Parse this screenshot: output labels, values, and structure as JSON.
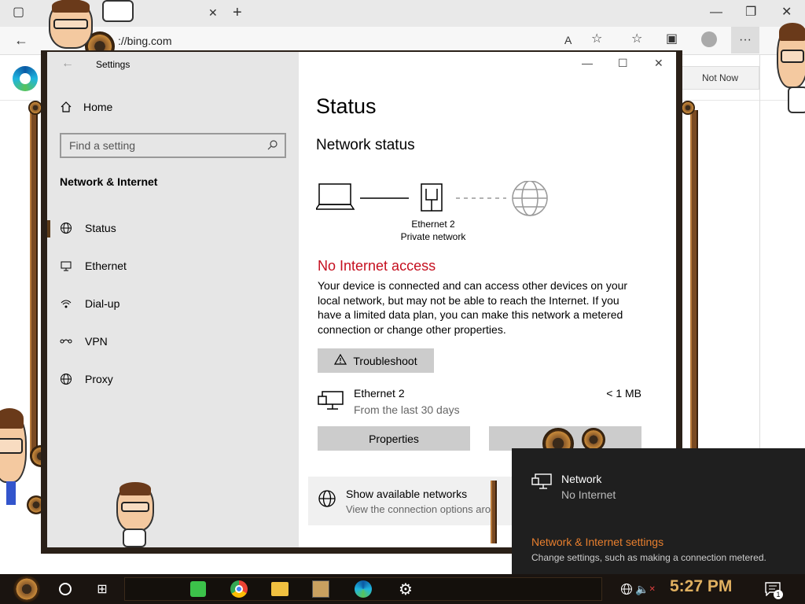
{
  "browser": {
    "url": "https://bing.com",
    "url_display": "://bing.com",
    "new_tab_icon": "plus-icon",
    "back_icon": "back-arrow-icon",
    "not_now_label": "Not Now"
  },
  "settings": {
    "window_title": "Settings",
    "sidebar": {
      "home_label": "Home",
      "search_placeholder": "Find a setting",
      "section_title": "Network & Internet",
      "items": [
        {
          "label": "Status",
          "icon": "globe-icon",
          "selected": true
        },
        {
          "label": "Ethernet",
          "icon": "monitor-icon",
          "selected": false
        },
        {
          "label": "Dial-up",
          "icon": "dialup-icon",
          "selected": false
        },
        {
          "label": "VPN",
          "icon": "vpn-icon",
          "selected": false
        },
        {
          "label": "Proxy",
          "icon": "globe-icon",
          "selected": false
        }
      ]
    },
    "content": {
      "page_title": "Status",
      "section_title": "Network status",
      "diagram": {
        "adapter_name": "Ethernet 2",
        "network_type": "Private network"
      },
      "alert_title": "No Internet access",
      "description": "Your device is connected and can access other devices on your local network, but may not be able to reach the Internet. If you have a limited data plan, you can make this network a metered connection or change other properties.",
      "troubleshoot_label": "Troubleshoot",
      "adapter": {
        "name": "Ethernet 2",
        "period": "From the last 30 days",
        "usage": "< 1 MB"
      },
      "properties_label": "Properties",
      "show_networks_title": "Show available networks",
      "show_networks_sub": "View the connection options aro"
    }
  },
  "flyout": {
    "network_label": "Network",
    "network_status": "No Internet",
    "settings_link": "Network & Internet settings",
    "settings_sub": "Change settings, such as making a connection metered."
  },
  "taskbar": {
    "clock": "5:27 PM",
    "notification_count": "1"
  },
  "colors": {
    "alert_red": "#c50f1f",
    "link_orange": "#e87f2e",
    "clock_gold": "#e0b060",
    "sidebar_bg": "#e6e6e6",
    "accent_brown": "#5a3a1a"
  }
}
